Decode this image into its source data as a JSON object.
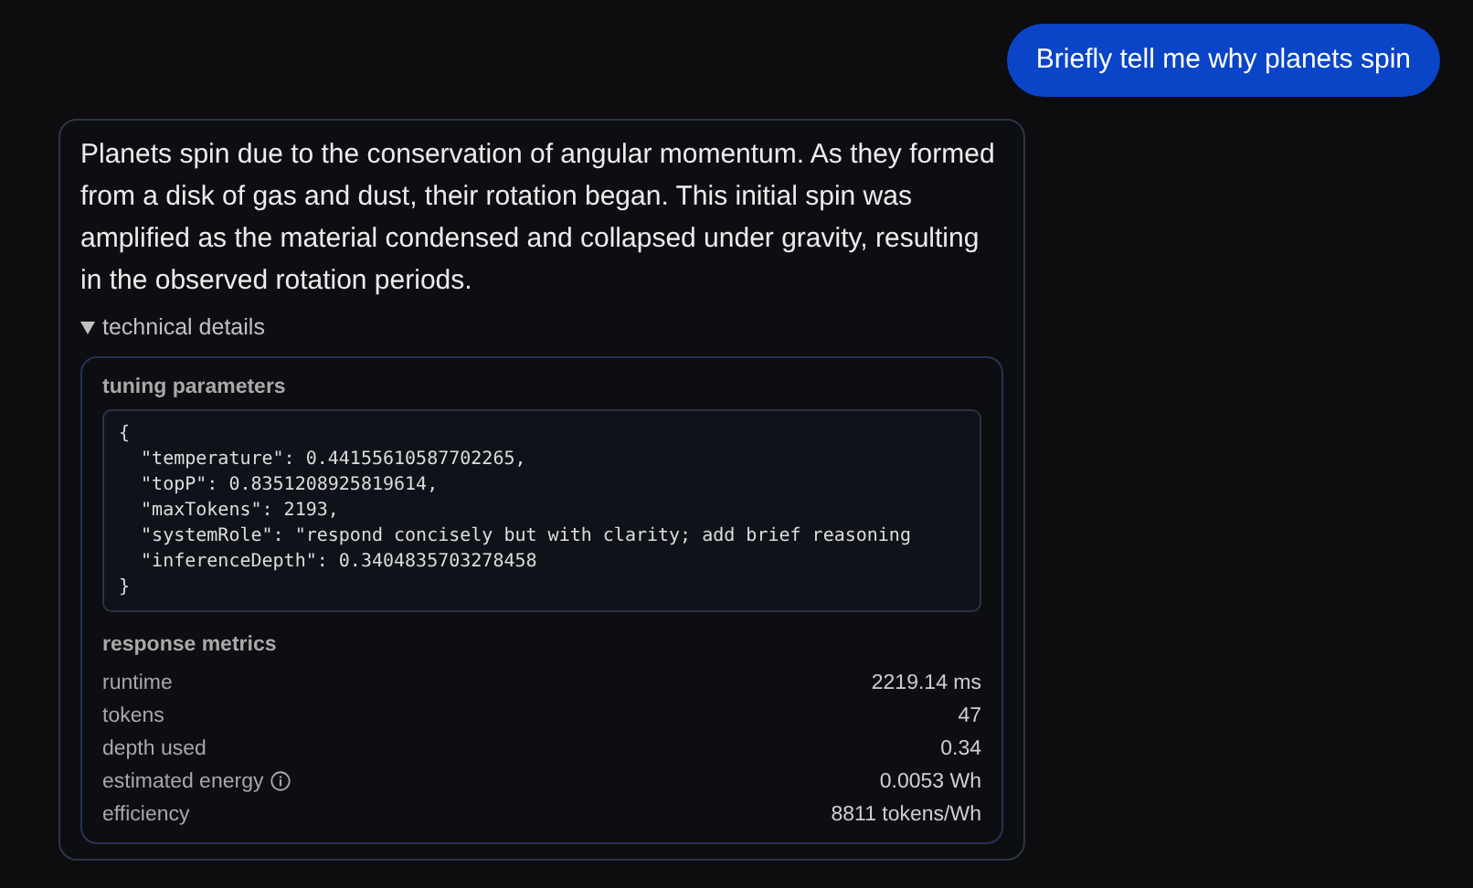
{
  "user_message": {
    "text": "Briefly tell me why planets spin"
  },
  "assistant_message": {
    "text": "Planets spin due to the conservation of angular momentum. As they formed from a disk of gas and dust, their rotation began. This initial spin was amplified as the material condensed and collapsed under gravity, resulting in the observed rotation periods.",
    "details": {
      "summary": "technical details",
      "expanded": true,
      "tuning_parameters": {
        "title": "tuning parameters",
        "code_lines": [
          "{",
          "  \"temperature\": 0.44155610587702265,",
          "  \"topP\": 0.8351208925819614,",
          "  \"maxTokens\": 2193,",
          "  \"systemRole\": \"respond concisely but with clarity; add brief reasoning",
          "  \"inferenceDepth\": 0.3404835703278458",
          "}"
        ]
      },
      "response_metrics": {
        "title": "response metrics",
        "rows": [
          {
            "label": "runtime",
            "value": "2219.14 ms",
            "info": false
          },
          {
            "label": "tokens",
            "value": "47",
            "info": false
          },
          {
            "label": "depth used",
            "value": "0.34",
            "info": false
          },
          {
            "label": "estimated energy",
            "value": "0.0053 Wh",
            "info": true
          },
          {
            "label": "efficiency",
            "value": "8811 tokens/Wh",
            "info": false
          }
        ]
      }
    }
  }
}
